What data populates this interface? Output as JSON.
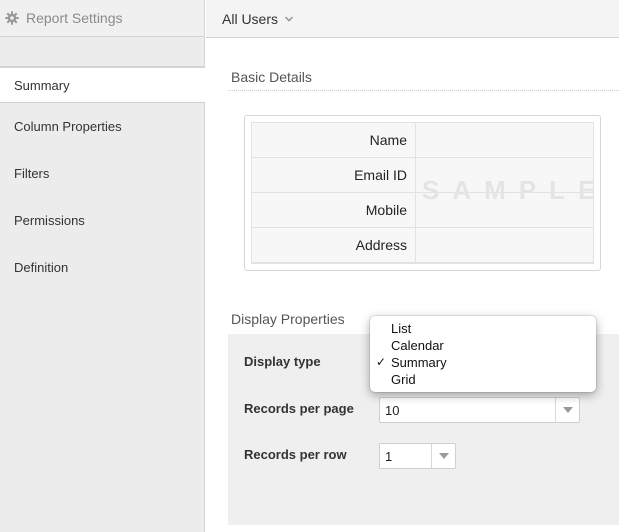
{
  "sidebar": {
    "title": "Report Settings",
    "items": [
      {
        "label": "Summary",
        "active": true
      },
      {
        "label": "Column Properties"
      },
      {
        "label": "Filters"
      },
      {
        "label": "Permissions"
      },
      {
        "label": "Definition"
      }
    ]
  },
  "topbar": {
    "user_filter": "All Users"
  },
  "basic_details": {
    "title": "Basic Details",
    "fields": [
      "Name",
      "Email ID",
      "Mobile",
      "Address"
    ],
    "watermark": "SAMPLE"
  },
  "display_properties": {
    "title": "Display Properties",
    "display_type_label": "Display type",
    "display_type_options": [
      "List",
      "Calendar",
      "Summary",
      "Grid"
    ],
    "display_type_selected": "Summary",
    "records_per_page_label": "Records per page",
    "records_per_page_value": "10",
    "records_per_row_label": "Records per row",
    "records_per_row_value": "1"
  },
  "icons": {
    "gear": "gear-icon",
    "caret": "chevron-down-icon",
    "check": "checkmark-icon"
  },
  "colors": {
    "sidebar_bg": "#ececec",
    "panel_bg": "#efefef",
    "watermark": "#e4e4e4"
  }
}
